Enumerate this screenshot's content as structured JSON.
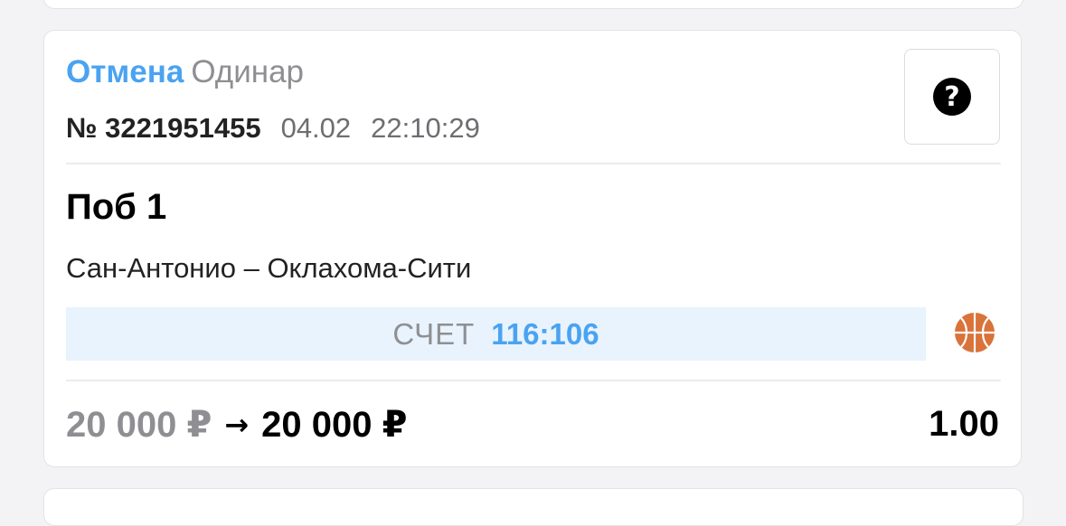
{
  "bet": {
    "status": "Отмена",
    "type": "Одинар",
    "number": "№ 3221951455",
    "date": "04.02",
    "time": "22:10:29",
    "outcome": "Поб 1",
    "event": "Сан-Антонио – Оклахома-Сити",
    "score_label": "СЧЕТ",
    "score_value": "116:106",
    "sport_icon": "basketball-icon",
    "stake": "20 000 ₽",
    "arrow": "→",
    "payout": "20 000 ₽",
    "odds": "1.00"
  },
  "help": {
    "icon": "question-icon",
    "glyph": "?"
  },
  "colors": {
    "status": "#4aa3f0",
    "score_bg": "#e8f3fd",
    "score_value": "#4aa3f0",
    "muted": "#8f8f93",
    "basketball": "#d9733a"
  }
}
